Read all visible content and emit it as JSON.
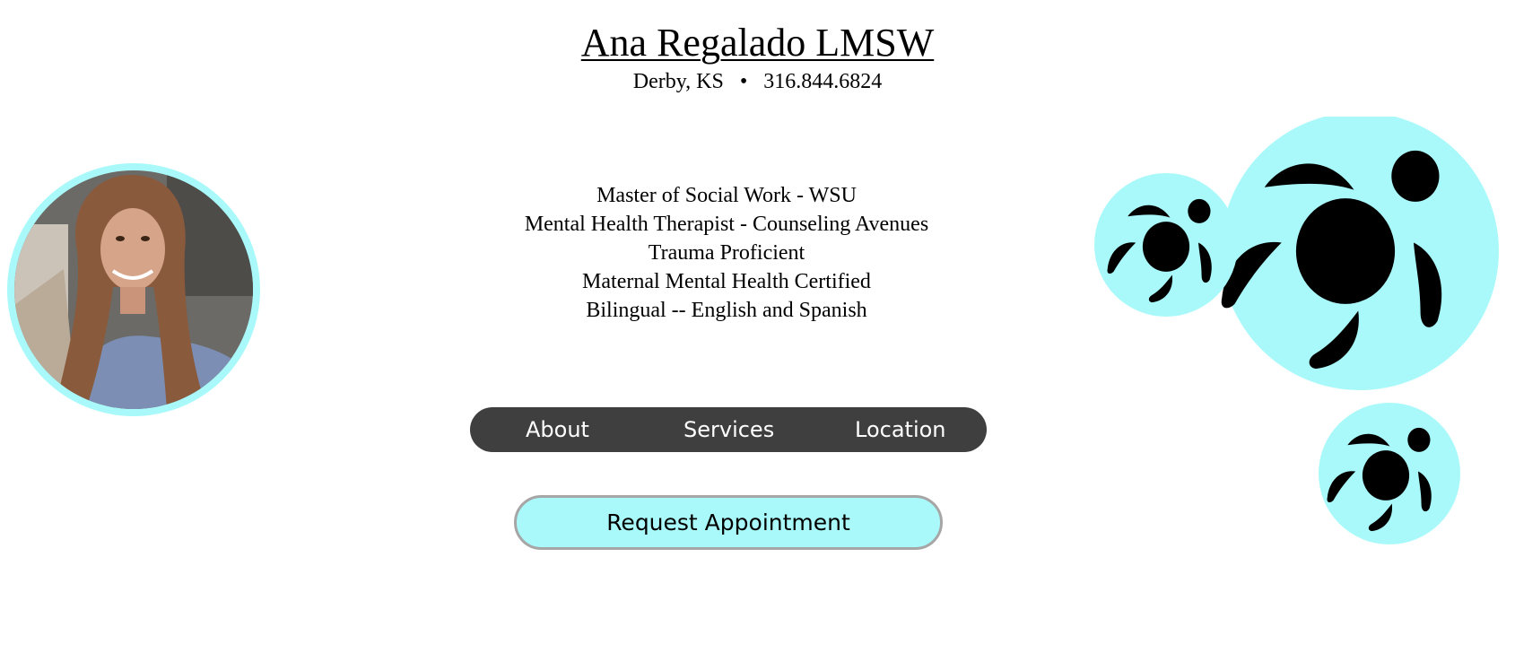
{
  "header": {
    "name": "Ana Regalado LMSW",
    "location": "Derby, KS",
    "separator": "•",
    "phone": "316.844.6824"
  },
  "credentials": [
    "Master of Social Work - WSU",
    "Mental Health Therapist - Counseling Avenues",
    "Trauma Proficient",
    "Maternal Mental Health Certified",
    "Bilingual -- English and Spanish"
  ],
  "nav": {
    "about": "About",
    "services": "Services",
    "location": "Location"
  },
  "request_button": "Request Appointment",
  "decor": {
    "photo": "profile-photo",
    "turtles": "sea-turtle-icons"
  },
  "colors": {
    "accent": "#aaf9fa",
    "nav_bg": "#3f3f3f",
    "button_border": "#a6a6a6"
  }
}
